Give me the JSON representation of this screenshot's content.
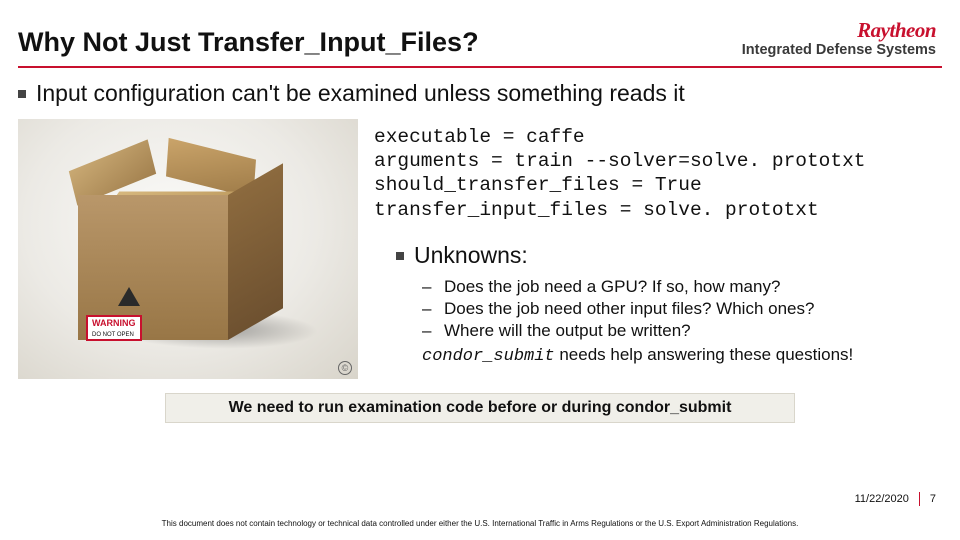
{
  "header": {
    "title": "Why Not Just Transfer_Input_Files?",
    "logo_brand": "Raytheon",
    "logo_subtitle": "Integrated Defense Systems"
  },
  "bullet1": "Input configuration can't be examined unless something reads it",
  "code": "executable = caffe\narguments = train --solver=solve. prototxt\nshould_transfer_files = True\ntransfer_input_files = solve. prototxt",
  "image": {
    "warning_label": "WARNING",
    "warning_sub": "DO NOT OPEN",
    "cc": "©"
  },
  "unknowns": {
    "heading": "Unknowns:",
    "items": [
      "Does the job need a GPU? If so, how many?",
      "Does the job need other input files? Which ones?",
      "Where will the output be written?"
    ],
    "help_code": "condor_submit",
    "help_rest": " needs help answering these questions!"
  },
  "callout": "We need to run examination code before or during condor_submit",
  "footer": {
    "date": "11/22/2020",
    "page": "7"
  },
  "disclaimer": "This document does not contain technology or technical data controlled under either the U.S. International Traffic in Arms Regulations or the U.S. Export Administration Regulations."
}
